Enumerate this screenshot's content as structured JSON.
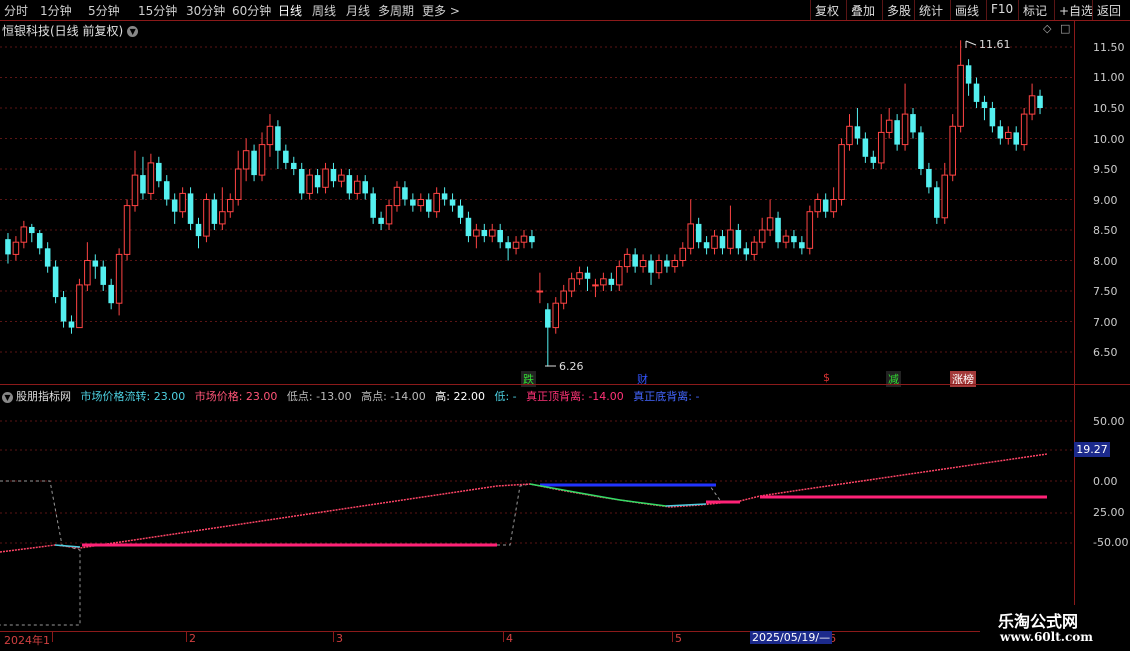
{
  "toolbar": {
    "periods": [
      "分时",
      "1分钟",
      "5分钟",
      "15分钟",
      "30分钟",
      "60分钟",
      "日线",
      "周线",
      "月线",
      "多周期",
      "更多 >"
    ],
    "active_period": "日线",
    "actions": [
      "复权",
      "叠加",
      "多股",
      "统计",
      "画线",
      "F10",
      "标记",
      "+自选",
      "返回"
    ]
  },
  "stock_title": "恒银科技(日线 前复权)",
  "price_axis": [
    "11.50",
    "11.00",
    "10.50",
    "10.00",
    "9.50",
    "9.00",
    "8.50",
    "8.00",
    "7.50",
    "7.00",
    "6.50"
  ],
  "high_marker": "11.61",
  "low_marker": "6.26",
  "events": [
    {
      "text": "跌",
      "color": "#33dd33",
      "bg": "#222222"
    },
    {
      "text": "财",
      "color": "#3355ff",
      "bg": "#000000"
    },
    {
      "text": "$",
      "color": "#dd3333",
      "bg": "#000000"
    },
    {
      "text": "减",
      "color": "#33dd33",
      "bg": "#222222"
    },
    {
      "text": "涨榜",
      "color": "#ffffff",
      "bg": "#a33a3a"
    }
  ],
  "indicator": {
    "name": "股朋指标网",
    "items": [
      {
        "text": "市场价格流转: 23.00",
        "color": "#4dd0e1"
      },
      {
        "text": "市场价格: 23.00",
        "color": "#ff5577"
      },
      {
        "text": "低点: -13.00",
        "color": "#bbbbbb"
      },
      {
        "text": "高点: -14.00",
        "color": "#bbbbbb"
      },
      {
        "text": "高: 22.00",
        "color": "#ffffff"
      },
      {
        "text": "低: -",
        "color": "#4dd0e1"
      },
      {
        "text": "真正顶背离: -14.00",
        "color": "#ff3377"
      },
      {
        "text": "真正底背离: -",
        "color": "#4466ff"
      }
    ],
    "axis": [
      "50.00",
      "25.00",
      "0.00",
      "-25.00",
      "-50.00"
    ],
    "current_value": "19.27"
  },
  "dates": [
    "2024年1",
    "2",
    "3",
    "4",
    "5",
    "6"
  ],
  "cursor_date": "2025/05/19/—",
  "watermark": {
    "line1": "乐淘公式网",
    "line2": "www.60lt.com"
  },
  "colors": {
    "up": "#ff4444",
    "down": "#54f0f0",
    "grid": "#5a1515",
    "accent": "#8b1a1a"
  },
  "candles": [
    [
      8.35,
      8.1,
      8.45,
      7.95
    ],
    [
      8.1,
      8.3,
      8.4,
      8.0
    ],
    [
      8.3,
      8.55,
      8.65,
      8.2
    ],
    [
      8.55,
      8.45,
      8.6,
      8.3
    ],
    [
      8.45,
      8.2,
      8.5,
      8.1
    ],
    [
      8.2,
      7.9,
      8.3,
      7.8
    ],
    [
      7.9,
      7.4,
      8.0,
      7.3
    ],
    [
      7.4,
      7.0,
      7.5,
      6.9
    ],
    [
      7.0,
      6.9,
      7.1,
      6.8
    ],
    [
      6.9,
      7.6,
      7.7,
      6.9
    ],
    [
      7.6,
      8.0,
      8.3,
      7.5
    ],
    [
      8.0,
      7.9,
      8.1,
      7.7
    ],
    [
      7.9,
      7.6,
      8.0,
      7.5
    ],
    [
      7.6,
      7.3,
      7.7,
      7.2
    ],
    [
      7.3,
      8.1,
      8.2,
      7.1
    ],
    [
      8.1,
      8.9,
      9.0,
      8.0
    ],
    [
      8.9,
      9.4,
      9.8,
      8.8
    ],
    [
      9.4,
      9.1,
      9.7,
      9.0
    ],
    [
      9.1,
      9.6,
      9.75,
      9.0
    ],
    [
      9.6,
      9.3,
      9.7,
      9.2
    ],
    [
      9.3,
      9.0,
      9.4,
      8.9
    ],
    [
      9.0,
      8.8,
      9.1,
      8.6
    ],
    [
      8.8,
      9.1,
      9.2,
      8.7
    ],
    [
      9.1,
      8.6,
      9.2,
      8.5
    ],
    [
      8.6,
      8.4,
      8.7,
      8.2
    ],
    [
      8.4,
      9.0,
      9.1,
      8.3
    ],
    [
      9.0,
      8.6,
      9.1,
      8.5
    ],
    [
      8.6,
      8.8,
      9.2,
      8.5
    ],
    [
      8.8,
      9.0,
      9.1,
      8.7
    ],
    [
      9.0,
      9.5,
      9.8,
      8.9
    ],
    [
      9.5,
      9.8,
      10.0,
      9.3
    ],
    [
      9.8,
      9.4,
      9.9,
      9.3
    ],
    [
      9.4,
      9.9,
      10.1,
      9.3
    ],
    [
      9.9,
      10.2,
      10.4,
      9.7
    ],
    [
      10.2,
      9.8,
      10.3,
      9.5
    ],
    [
      9.8,
      9.6,
      9.9,
      9.5
    ],
    [
      9.6,
      9.5,
      9.7,
      9.4
    ],
    [
      9.5,
      9.1,
      9.6,
      9.0
    ],
    [
      9.1,
      9.4,
      9.5,
      9.0
    ],
    [
      9.4,
      9.2,
      9.5,
      9.1
    ],
    [
      9.2,
      9.5,
      9.6,
      9.1
    ],
    [
      9.5,
      9.3,
      9.6,
      9.2
    ],
    [
      9.3,
      9.4,
      9.5,
      9.2
    ],
    [
      9.4,
      9.1,
      9.5,
      9.0
    ],
    [
      9.1,
      9.3,
      9.4,
      9.0
    ],
    [
      9.3,
      9.1,
      9.4,
      9.0
    ],
    [
      9.1,
      8.7,
      9.2,
      8.6
    ],
    [
      8.7,
      8.6,
      8.8,
      8.5
    ],
    [
      8.6,
      8.9,
      9.0,
      8.5
    ],
    [
      8.9,
      9.2,
      9.3,
      8.8
    ],
    [
      9.2,
      9.0,
      9.3,
      8.9
    ],
    [
      9.0,
      8.9,
      9.1,
      8.8
    ],
    [
      8.9,
      9.0,
      9.1,
      8.8
    ],
    [
      9.0,
      8.8,
      9.1,
      8.7
    ],
    [
      8.8,
      9.1,
      9.2,
      8.7
    ],
    [
      9.1,
      9.0,
      9.2,
      8.9
    ],
    [
      9.0,
      8.9,
      9.1,
      8.8
    ],
    [
      8.9,
      8.7,
      9.0,
      8.6
    ],
    [
      8.7,
      8.4,
      8.8,
      8.3
    ],
    [
      8.4,
      8.5,
      8.6,
      8.2
    ],
    [
      8.5,
      8.4,
      8.6,
      8.3
    ],
    [
      8.4,
      8.5,
      8.6,
      8.3
    ],
    [
      8.5,
      8.3,
      8.6,
      8.2
    ],
    [
      8.3,
      8.2,
      8.4,
      8.0
    ],
    [
      8.2,
      8.3,
      8.4,
      8.1
    ],
    [
      8.3,
      8.4,
      8.5,
      8.2
    ],
    [
      8.4,
      8.3,
      8.5,
      8.2
    ],
    [
      7.5,
      7.5,
      7.8,
      7.3
    ],
    [
      7.2,
      6.9,
      7.3,
      6.26
    ],
    [
      6.9,
      7.3,
      7.4,
      6.8
    ],
    [
      7.3,
      7.5,
      7.6,
      7.2
    ],
    [
      7.5,
      7.7,
      7.8,
      7.4
    ],
    [
      7.7,
      7.8,
      7.9,
      7.6
    ],
    [
      7.8,
      7.7,
      7.9,
      7.5
    ],
    [
      7.6,
      7.6,
      7.7,
      7.4
    ],
    [
      7.6,
      7.7,
      7.8,
      7.5
    ],
    [
      7.7,
      7.6,
      7.8,
      7.5
    ],
    [
      7.6,
      7.9,
      8.0,
      7.5
    ],
    [
      7.9,
      8.1,
      8.2,
      7.8
    ],
    [
      8.1,
      7.9,
      8.2,
      7.8
    ],
    [
      7.9,
      8.0,
      8.1,
      7.8
    ],
    [
      8.0,
      7.8,
      8.1,
      7.6
    ],
    [
      7.8,
      8.0,
      8.1,
      7.7
    ],
    [
      8.0,
      7.9,
      8.1,
      7.8
    ],
    [
      7.9,
      8.0,
      8.1,
      7.8
    ],
    [
      8.0,
      8.2,
      8.3,
      7.9
    ],
    [
      8.2,
      8.6,
      9.0,
      8.1
    ],
    [
      8.6,
      8.3,
      8.7,
      8.2
    ],
    [
      8.3,
      8.2,
      8.4,
      8.1
    ],
    [
      8.2,
      8.4,
      8.5,
      8.1
    ],
    [
      8.4,
      8.2,
      8.5,
      8.1
    ],
    [
      8.2,
      8.5,
      8.9,
      8.1
    ],
    [
      8.5,
      8.2,
      8.6,
      8.1
    ],
    [
      8.2,
      8.1,
      8.3,
      8.0
    ],
    [
      8.1,
      8.3,
      8.4,
      8.0
    ],
    [
      8.3,
      8.5,
      8.7,
      8.2
    ],
    [
      8.5,
      8.7,
      9.0,
      8.4
    ],
    [
      8.7,
      8.3,
      8.8,
      8.2
    ],
    [
      8.3,
      8.4,
      8.5,
      8.2
    ],
    [
      8.4,
      8.3,
      8.5,
      8.2
    ],
    [
      8.3,
      8.2,
      8.4,
      8.1
    ],
    [
      8.2,
      8.8,
      8.9,
      8.1
    ],
    [
      8.8,
      9.0,
      9.1,
      8.7
    ],
    [
      9.0,
      8.8,
      9.1,
      8.7
    ],
    [
      8.8,
      9.0,
      9.2,
      8.7
    ],
    [
      9.0,
      9.9,
      10.0,
      8.9
    ],
    [
      9.9,
      10.2,
      10.4,
      9.8
    ],
    [
      10.2,
      10.0,
      10.5,
      9.9
    ],
    [
      10.0,
      9.7,
      10.1,
      9.6
    ],
    [
      9.7,
      9.6,
      9.8,
      9.5
    ],
    [
      9.6,
      10.1,
      10.4,
      9.5
    ],
    [
      10.1,
      10.3,
      10.5,
      10.0
    ],
    [
      10.3,
      9.9,
      10.4,
      9.8
    ],
    [
      9.9,
      10.4,
      10.9,
      9.8
    ],
    [
      10.4,
      10.1,
      10.5,
      10.0
    ],
    [
      10.1,
      9.5,
      10.2,
      9.4
    ],
    [
      9.5,
      9.2,
      9.6,
      9.1
    ],
    [
      9.2,
      8.7,
      9.3,
      8.6
    ],
    [
      8.7,
      9.4,
      9.6,
      8.6
    ],
    [
      9.4,
      10.2,
      10.4,
      9.3
    ],
    [
      10.2,
      11.2,
      11.61,
      10.1
    ],
    [
      11.2,
      10.9,
      11.3,
      10.7
    ],
    [
      10.9,
      10.6,
      11.0,
      10.5
    ],
    [
      10.6,
      10.5,
      10.7,
      10.3
    ],
    [
      10.5,
      10.2,
      10.6,
      10.1
    ],
    [
      10.2,
      10.0,
      10.3,
      9.9
    ],
    [
      10.0,
      10.1,
      10.2,
      9.9
    ],
    [
      10.1,
      9.9,
      10.2,
      9.8
    ],
    [
      9.9,
      10.4,
      10.5,
      9.8
    ],
    [
      10.4,
      10.7,
      10.9,
      10.3
    ],
    [
      10.7,
      10.5,
      10.8,
      10.4
    ]
  ]
}
